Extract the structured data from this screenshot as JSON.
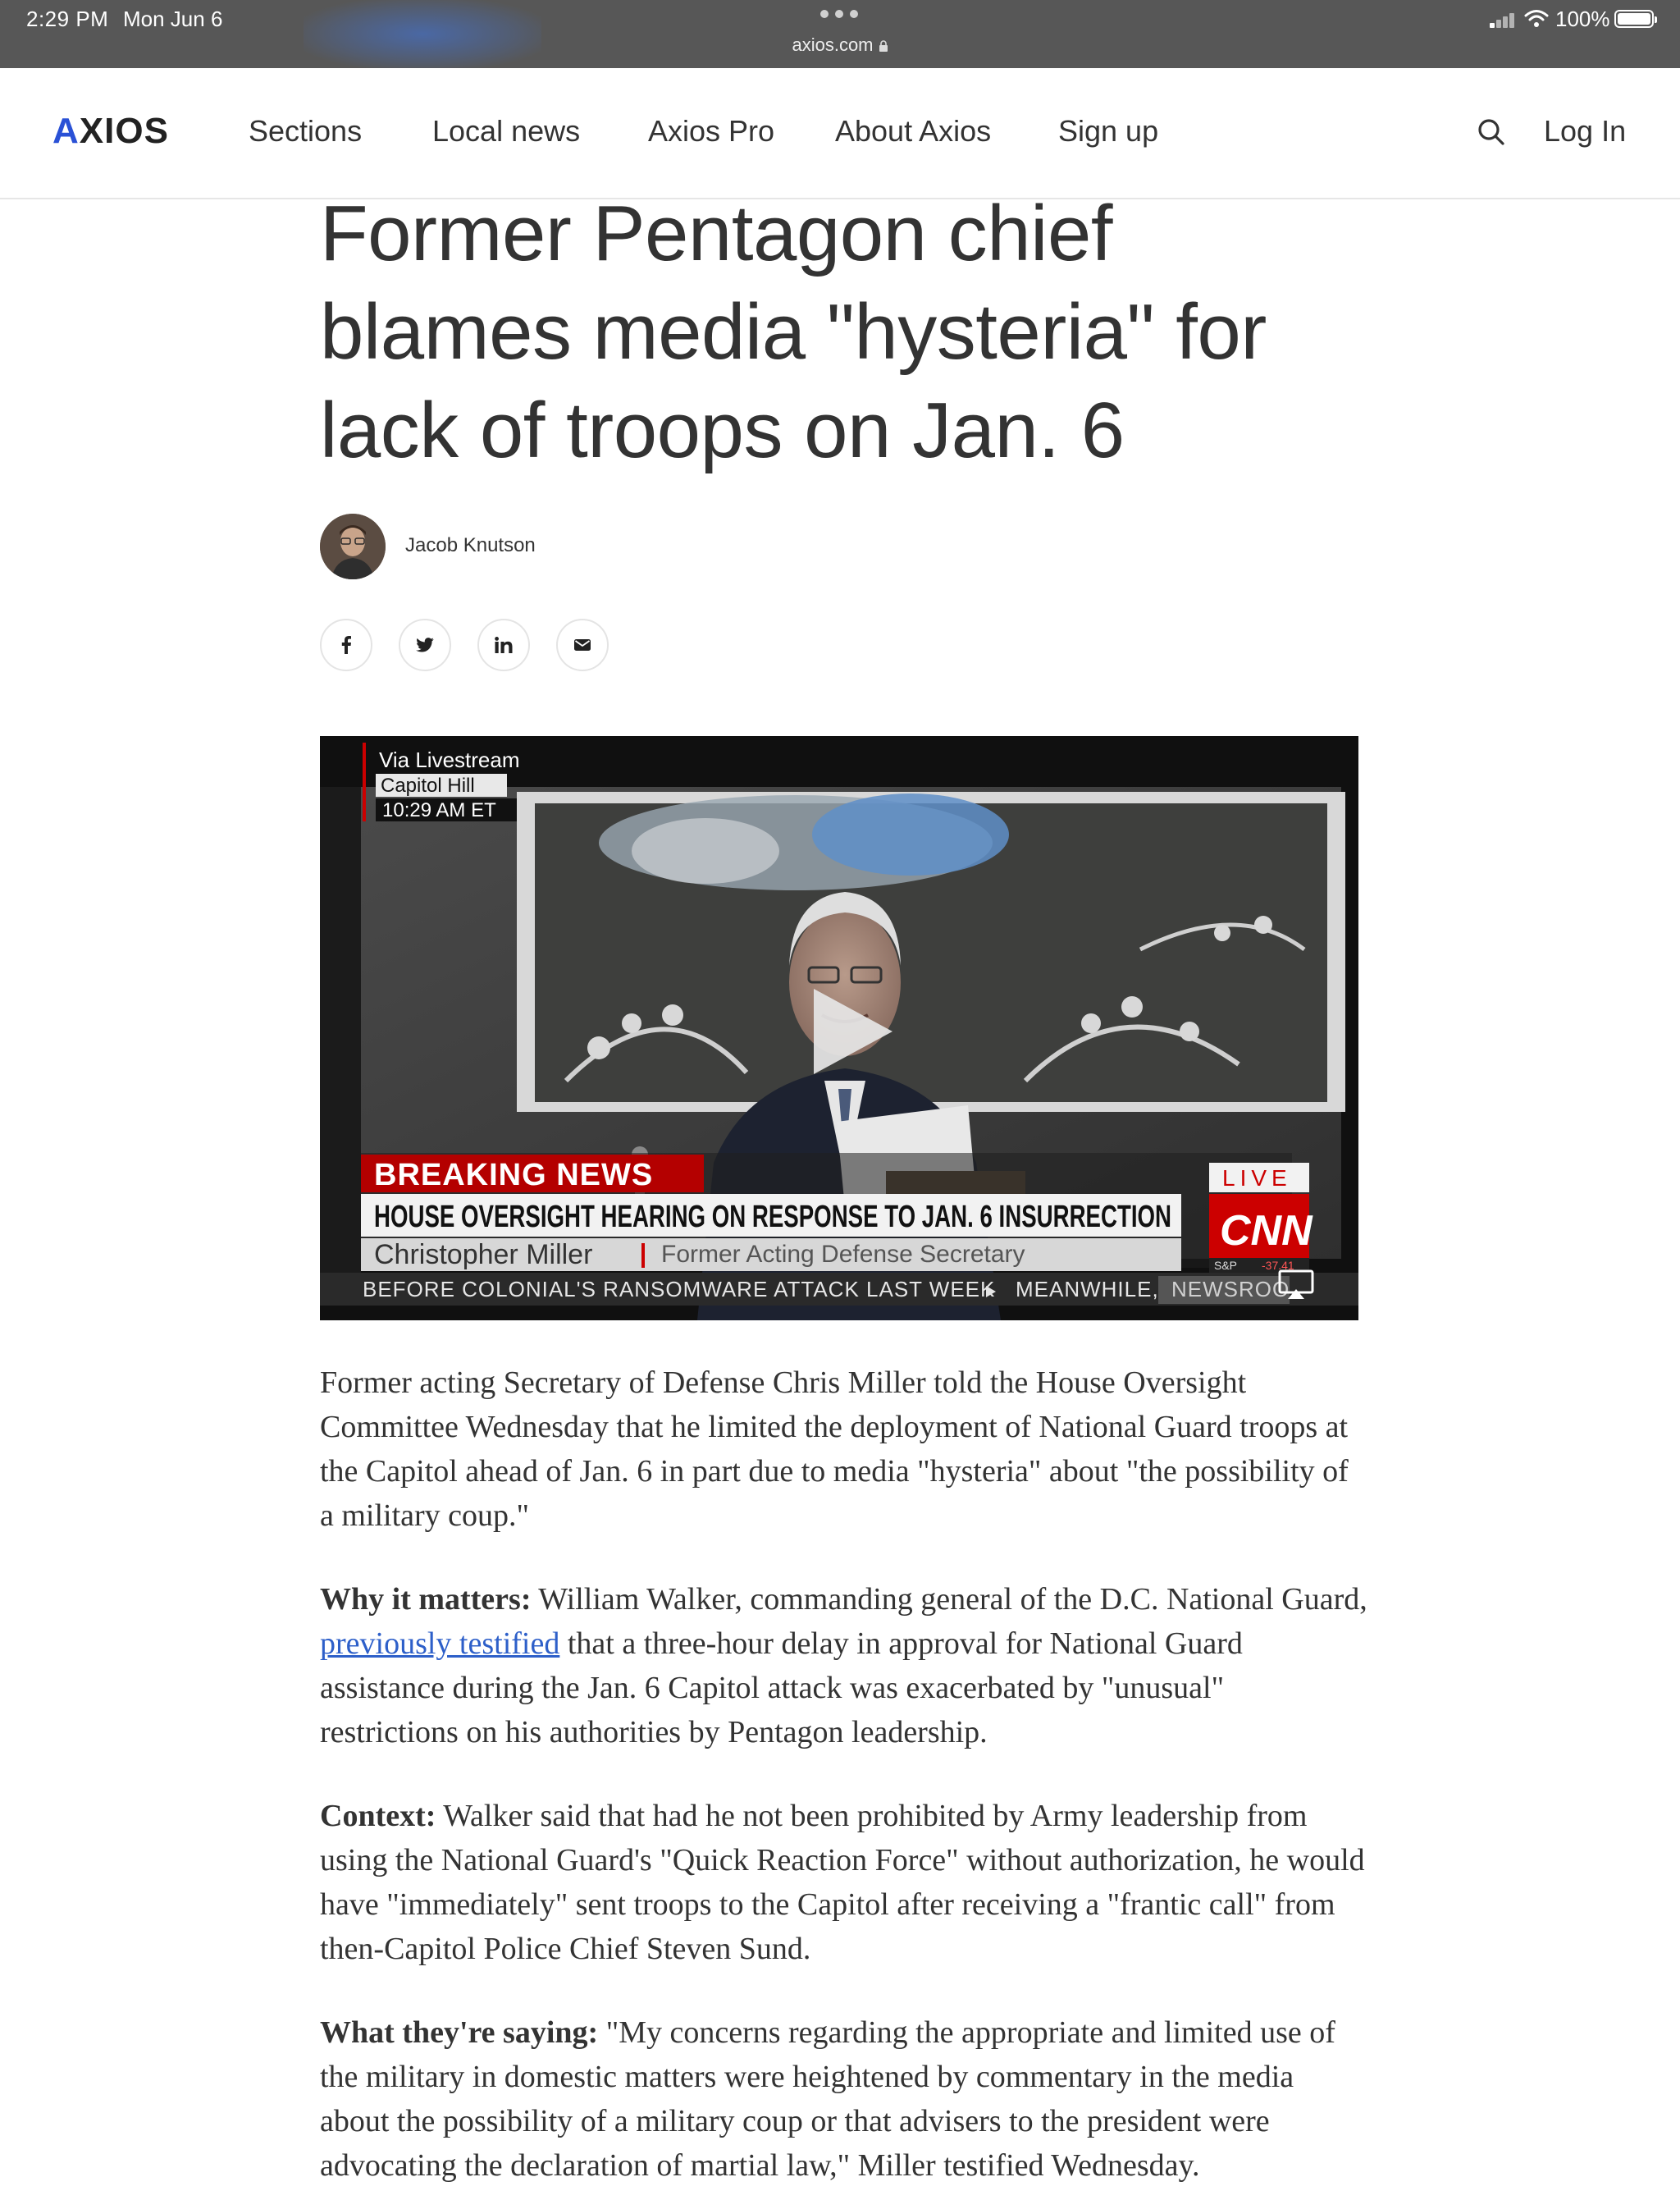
{
  "status_bar": {
    "time": "2:29 PM",
    "date": "Mon Jun 6",
    "url": "axios.com",
    "battery": "100%"
  },
  "nav": {
    "logo": "AXIOS",
    "links": [
      "Sections",
      "Local news",
      "Axios Pro",
      "About Axios",
      "Sign up"
    ],
    "login": "Log In"
  },
  "article": {
    "headline": "Former Pentagon chief blames media \"hysteria\" for lack of troops on Jan. 6",
    "author": "Jacob Knutson",
    "share": [
      "facebook-icon",
      "twitter-icon",
      "linkedin-icon",
      "email-icon"
    ]
  },
  "video": {
    "source_line1": "Via Livestream",
    "source_line2": "Capitol Hill",
    "source_time": "10:29 AM ET",
    "breaking": "BREAKING NEWS",
    "headline": "HOUSE OVERSIGHT HEARING ON RESPONSE TO JAN. 6 INSURRECTION",
    "speaker": "Christopher Miller",
    "speaker_title": "Former Acting Defense Secretary",
    "live": "LIVE",
    "network": "CNN",
    "ticker_market": "S&P",
    "ticker_value": "-37.41",
    "ticker_text": "BEFORE COLONIAL'S RANSOMWARE ATTACK LAST WEEK",
    "ticker_next": "MEANWHILE,",
    "ticker_newsroom": "NEWSROO"
  },
  "body": {
    "p1": "Former acting Secretary of Defense Chris Miller told the House Oversight Committee Wednesday that he limited the deployment of National Guard troops at the Capitol ahead of Jan. 6 in part due to media \"hysteria\" about \"the possibility of a military coup.\"",
    "p2_label": "Why it matters:",
    "p2_pre": " William Walker, commanding general of the D.C. National Guard, ",
    "p2_link": "previously testified",
    "p2_post": " that a three-hour delay in approval for National Guard assistance during the Jan. 6 Capitol attack was exacerbated by \"unusual\" restrictions on his authorities by Pentagon leadership.",
    "p3_label": "Context:",
    "p3_text": " Walker said that had he not been prohibited by Army leadership from using the National Guard's \"Quick Reaction Force\" without authorization, he would have \"immediately\" sent troops to the Capitol after receiving a \"frantic call\" from then-Capitol Police Chief Steven Sund.",
    "p4_label": "What they're saying:",
    "p4_text": " \"My concerns regarding the appropriate and limited use of the military in domestic matters were heightened by commentary in the media about the possibility of a military coup or that advisers to the president were advocating the declaration of martial law,\" Miller testified Wednesday."
  },
  "colors": {
    "accent": "#2a51d6",
    "link": "#2d5fc9",
    "status_bar": "#575757",
    "cnn_red": "#cc0000"
  }
}
